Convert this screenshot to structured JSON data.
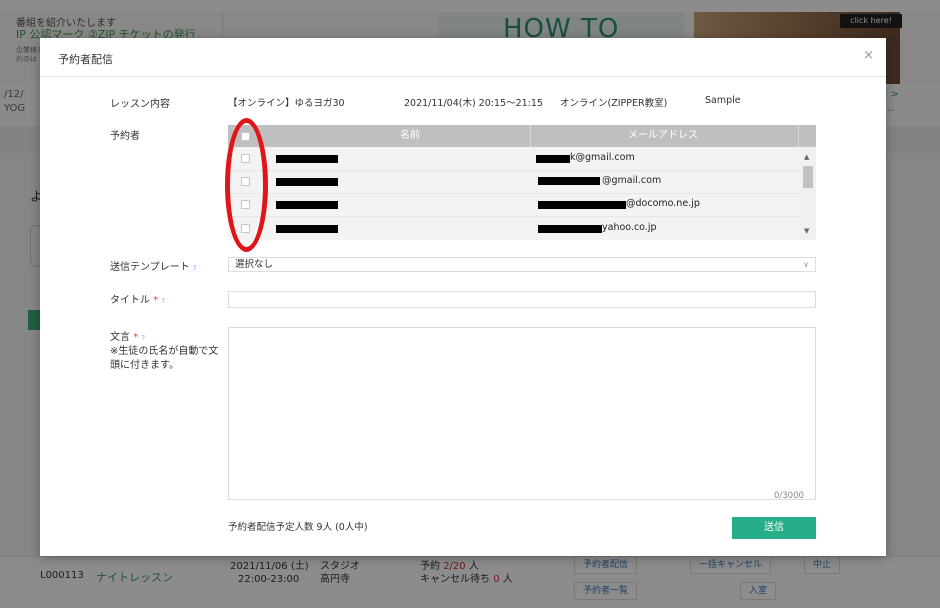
{
  "background": {
    "notice_text": "番組を紹介いたします",
    "links_text": "IP 公認マーク  ②ZIP チケットの発行",
    "small_text": [
      "企業様と",
      "れのは"
    ],
    "banner_text": "HOW TO",
    "click_here": "click here!",
    "breadcrumb_left": [
      "/12/",
      "YOG"
    ],
    "breadcrumb_right": [
      "RE >",
      "ア…"
    ],
    "glyph": "よ",
    "lesson_row": {
      "code": "L000113",
      "name": "ナイトレッスン",
      "date": "2021/11/06 (土)",
      "time": "22:00-23:00",
      "venue": "スタジオ",
      "place": "高円寺",
      "booking_label": "予約",
      "booking_value": "2/20",
      "booking_unit": "人",
      "cancel_label": "キャンセル待ち",
      "cancel_value": "0",
      "cancel_unit": "人",
      "btn_reservation_mail": "予約者配信",
      "btn_reservation_list": "予約者一覧",
      "btn_cancel": "一括キャンセル",
      "btn_cancel_short": "中止",
      "btn_enter": "入室"
    }
  },
  "modal": {
    "title": "予約者配信",
    "close": "×",
    "lesson_label": "レッスン内容",
    "lesson": {
      "name": "【オンライン】ゆるヨガ30",
      "datetime": "2021/11/04(木) 20:15～21:15",
      "venue": "オンライン(ZIPPER教室)",
      "instructor": "Sample"
    },
    "recipients_label": "予約者",
    "table": {
      "col_name": "名前",
      "col_email": "メールアドレス",
      "rows": [
        {
          "email": "k@gmail.com",
          "checked": false
        },
        {
          "email": "@gmail.com",
          "checked": false
        },
        {
          "email": "@docomo.ne.jp",
          "checked": false
        },
        {
          "email": "yahoo.co.jp",
          "checked": false
        }
      ]
    },
    "template_label": "送信テンプレート",
    "template_value": "選択なし",
    "title_label": "タイトル",
    "body_label": "文言",
    "body_note": [
      "※生徒の氏名が自動で文",
      "頭に付きます。"
    ],
    "req_mark": "*",
    "help_mark": "?",
    "counter": "0/3000",
    "summary": "予約者配信予定人数 9人 (0人中)",
    "send_button": "送信"
  }
}
